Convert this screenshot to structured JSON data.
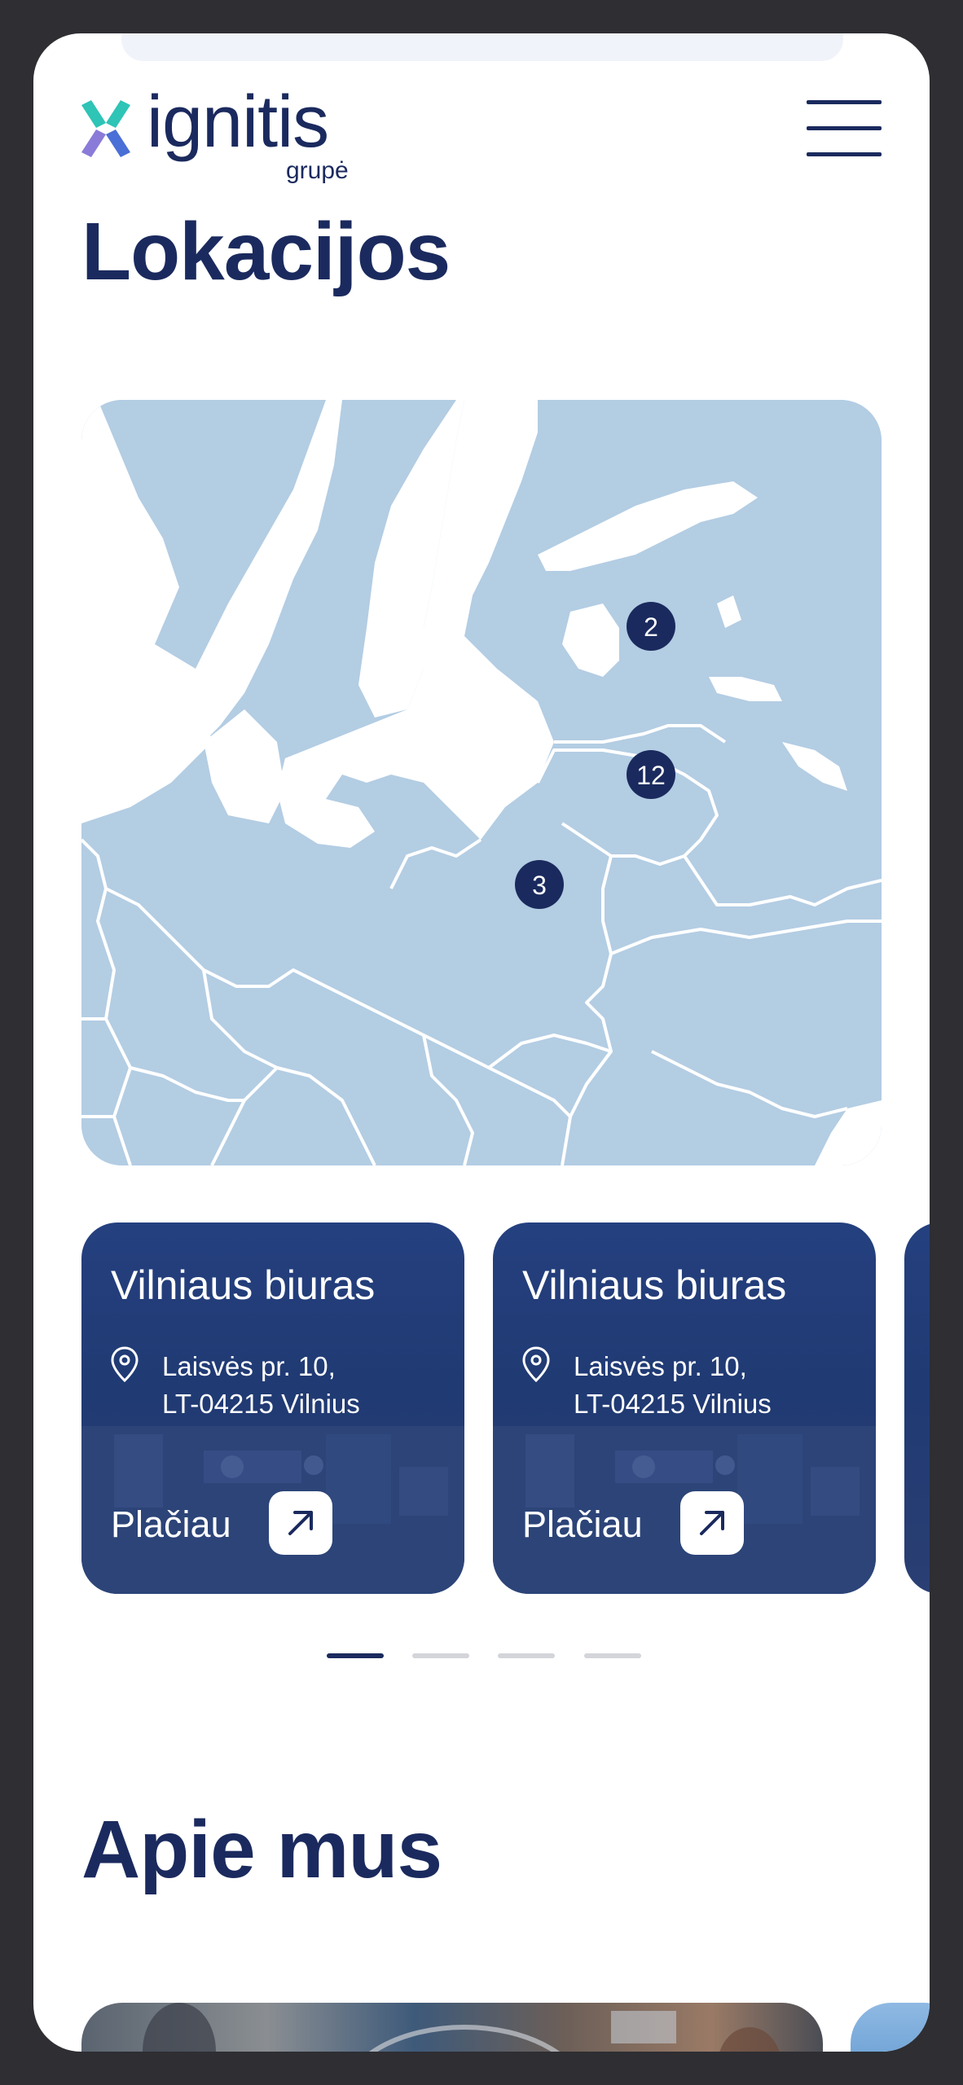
{
  "brand": {
    "name": "ignitis",
    "sub": "grupė",
    "colors": {
      "navy": "#1b2a5e",
      "teal": "#2ec4b6",
      "purple": "#8a7bd8",
      "blue": "#4a6fd6"
    }
  },
  "menu": {
    "icon": "hamburger-menu-icon"
  },
  "locations": {
    "title": "Lokacijos",
    "map": {
      "clusters": [
        {
          "count": "2"
        },
        {
          "count": "12"
        },
        {
          "count": "3"
        }
      ]
    },
    "cards": [
      {
        "title": "Vilniaus biuras",
        "address_line1": "Laisvės pr. 10,",
        "address_line2": "LT-04215 Vilnius",
        "link": "Plačiau",
        "icon": "arrow-up-right-icon"
      },
      {
        "title": "Vilniaus biuras",
        "address_line1": "Laisvės pr. 10,",
        "address_line2": "LT-04215 Vilnius",
        "link": "Plačiau",
        "icon": "arrow-up-right-icon"
      }
    ],
    "pagination": {
      "pages": 4,
      "current": 1
    }
  },
  "about": {
    "title": "Apie mus"
  }
}
